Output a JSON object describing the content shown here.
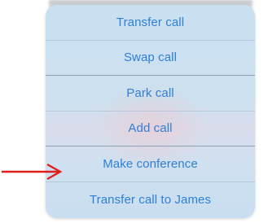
{
  "menu": {
    "items": [
      {
        "label": "Transfer call"
      },
      {
        "label": "Swap call"
      },
      {
        "label": "Park call"
      },
      {
        "label": "Add call"
      },
      {
        "label": "Make conference"
      },
      {
        "label": "Transfer call to James"
      }
    ]
  },
  "annotation": {
    "arrow_color": "#e0201b",
    "points_to": "Make conference"
  },
  "colors": {
    "menu_text": "#2f7fd6",
    "menu_background": "#cde0ef"
  }
}
